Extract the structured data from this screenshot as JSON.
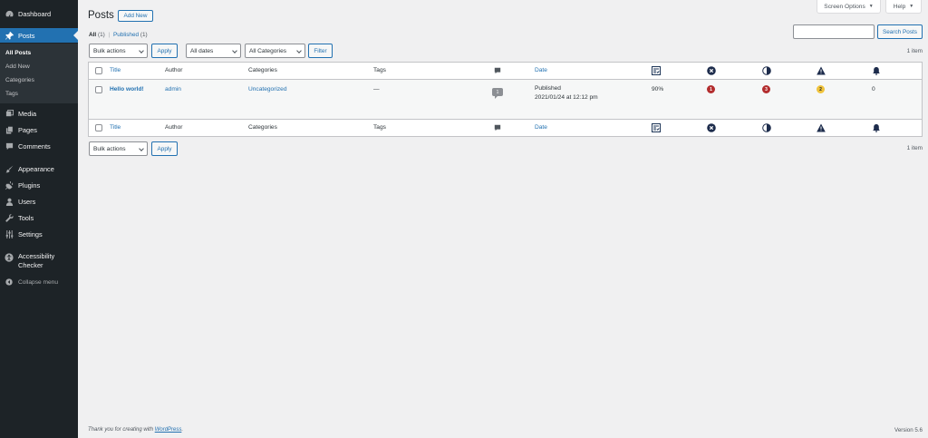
{
  "sidebar": {
    "dashboard": "Dashboard",
    "posts": "Posts",
    "submenu": [
      "All Posts",
      "Add New",
      "Categories",
      "Tags"
    ],
    "media": "Media",
    "pages": "Pages",
    "comments": "Comments",
    "appearance": "Appearance",
    "plugins": "Plugins",
    "users": "Users",
    "tools": "Tools",
    "settings": "Settings",
    "accessibility_line1": "Accessibility",
    "accessibility_line2": "Checker",
    "collapse": "Collapse menu"
  },
  "top": {
    "screen_options": "Screen Options",
    "help": "Help"
  },
  "header": {
    "title": "Posts",
    "add_new": "Add New"
  },
  "filters": {
    "all_label": "All",
    "all_count": "(1)",
    "separator": "|",
    "published_label": "Published",
    "published_count": "(1)",
    "bulk_actions": "Bulk actions",
    "apply": "Apply",
    "all_dates": "All dates",
    "all_categories": "All Categories",
    "filter": "Filter",
    "search_button": "Search Posts",
    "items_count": "1 item"
  },
  "table": {
    "columns": {
      "title": "Title",
      "author": "Author",
      "categories": "Categories",
      "tags": "Tags",
      "date": "Date"
    },
    "rows": [
      {
        "title": "Hello world!",
        "author": "admin",
        "categories": "Uncategorized",
        "tags": "—",
        "comments": "1",
        "status": "Published",
        "date": "2021/01/24 at 12:12 pm",
        "score": "90%",
        "errors": "1",
        "contrast": "3",
        "warnings": "2",
        "notices": "0"
      }
    ]
  },
  "colors": {
    "accent": "#2271b1",
    "sidebar": "#1d2327",
    "error": "#b32d2e",
    "warning": "#dba617"
  },
  "footer": {
    "thanks_prefix": "Thank you for creating with ",
    "thanks_link": "WordPress",
    "thanks_suffix": ".",
    "version": "Version 5.6"
  }
}
